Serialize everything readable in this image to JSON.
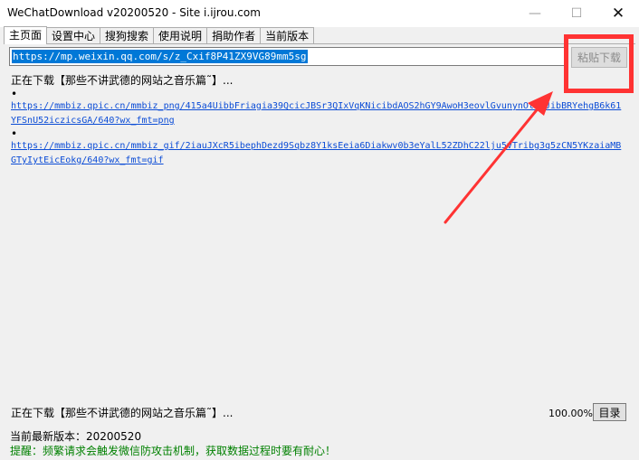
{
  "window": {
    "title": "WeChatDownload v20200520 - Site i.ijrou.com",
    "minimize_glyph": "—",
    "maximize_glyph": "☐",
    "close_glyph": "✕"
  },
  "tabs": [
    {
      "label": "主页面"
    },
    {
      "label": "设置中心"
    },
    {
      "label": "搜狗搜索"
    },
    {
      "label": "使用说明"
    },
    {
      "label": "捐助作者"
    },
    {
      "label": "当前版本"
    }
  ],
  "url_input": {
    "value": "https://mp.weixin.qq.com/s/z_Cxif8P41ZX9VG89mm5sg"
  },
  "paste_button": {
    "label": "粘贴下载"
  },
  "log": {
    "downloading_title": "正在下载【那些不讲武德的网站之音乐篇˜】...",
    "dot1": "•",
    "link1": "https://mmbiz.qpic.cn/mmbiz_png/415a4UibbFriagia39QcicJBSr3QIxVqKNicibdAOS2hGY9AwoH3eovlGvunynOtbXJibBRYehgB6k61YFSnU52iczicsGA/640?wx_fmt=png",
    "dot2": "•",
    "link2": "https://mmbiz.qpic.cn/mmbiz_gif/2iauJXcR5ibephDezd9Sqbz8Y1ksEeia6Diakwv0b3eYalL52ZDhC22lju5vTribg3q5zCN5YKzaiaMBGTyIytEicEokg/640?wx_fmt=gif"
  },
  "status": {
    "downloading": "正在下载【那些不讲武德的网站之音乐篇˜】...",
    "progress_text": "100.00%",
    "progress": 1.0
  },
  "dir_button": {
    "label": "目录"
  },
  "footer": {
    "latest_version": "当前最新版本：20200520",
    "tip": "提醒：频繁请求会触发微信防攻击机制，获取数据过程时要有耐心！"
  },
  "colors": {
    "annotation_red": "#ff3333",
    "link_blue": "#0b4cd6",
    "tip_green": "#008000",
    "selection_blue": "#0078d7"
  }
}
